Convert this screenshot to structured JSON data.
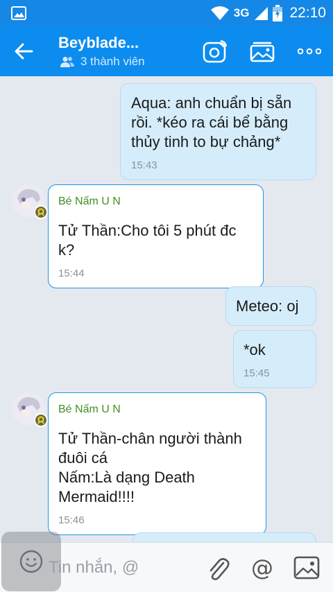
{
  "status_bar": {
    "network": "3G",
    "time": "22:10"
  },
  "header": {
    "title": "Beyblade...",
    "subtitle": "3 thành viên"
  },
  "messages": [
    {
      "direction": "out",
      "text": "Aqua: anh chuẩn bị sẵn\nrồi. *kéo ra cái bể bằng\nthủy tinh to bự chảng*",
      "time": "15:43"
    },
    {
      "direction": "in",
      "sender": "Bé Nấm U N",
      "text": "Tử Thần:Cho tôi 5 phút đc\nk?",
      "time": "15:44"
    },
    {
      "direction": "out",
      "text": "Meteo: oj",
      "time": ""
    },
    {
      "direction": "out",
      "text": "*ok",
      "time": "15:45"
    },
    {
      "direction": "in",
      "sender": "Bé Nấm U N",
      "text": "Tử Thần-chân người thành\nđuôi cá\nNấm:Là dạng Death\nMermaid!!!!",
      "time": "15:46"
    }
  ],
  "composer": {
    "placeholder": "Tin nhắn, @",
    "mention_symbol": "@"
  }
}
